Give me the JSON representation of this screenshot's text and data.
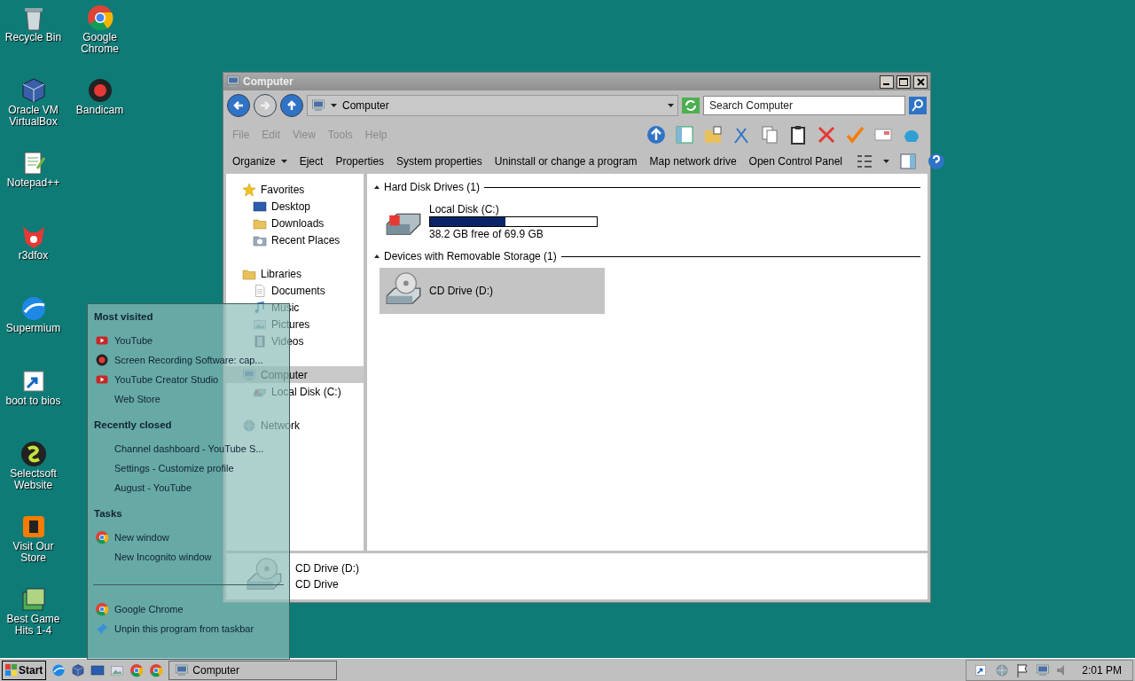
{
  "desktop": {
    "columns": [
      [
        {
          "label": "Recycle Bin",
          "kind": "recycle"
        },
        {
          "label": "Oracle VM VirtualBox",
          "kind": "cube"
        },
        {
          "label": "Notepad++",
          "kind": "notepad"
        },
        {
          "label": "r3dfox",
          "kind": "fox"
        },
        {
          "label": "Supermium",
          "kind": "globe"
        },
        {
          "label": "boot to bios",
          "kind": "shortcut"
        },
        {
          "label": "Selectsoft Website",
          "kind": "selectsoft"
        },
        {
          "label": "Visit Our Store",
          "kind": "store"
        },
        {
          "label": "Best Game Hits 1-4",
          "kind": "game"
        }
      ],
      [
        {
          "label": "Google Chrome",
          "kind": "chrome"
        },
        {
          "label": "Bandicam",
          "kind": "record"
        }
      ]
    ]
  },
  "window": {
    "title": "Computer",
    "address": "Computer",
    "search": {
      "placeholder": "Search Computer"
    },
    "menu": [
      {
        "label": "File",
        "disabled": true
      },
      {
        "label": "Edit",
        "disabled": true
      },
      {
        "label": "View",
        "disabled": true
      },
      {
        "label": "Tools",
        "disabled": true
      },
      {
        "label": "Help",
        "disabled": true
      }
    ],
    "commands": [
      {
        "label": "Organize",
        "dropdown": true
      },
      {
        "label": "Eject",
        "dropdown": false
      },
      {
        "label": "Properties",
        "dropdown": false
      },
      {
        "label": "System properties",
        "dropdown": false
      },
      {
        "label": "Uninstall or change a program",
        "dropdown": false
      },
      {
        "label": "Map network drive",
        "dropdown": false
      },
      {
        "label": "Open Control Panel",
        "dropdown": false
      }
    ],
    "navigation": [
      {
        "label": "Favorites",
        "kind": "star",
        "selected": false,
        "children": [
          {
            "label": "Desktop",
            "kind": "desktop",
            "selected": false
          },
          {
            "label": "Downloads",
            "kind": "folder",
            "selected": false
          },
          {
            "label": "Recent Places",
            "kind": "recent",
            "selected": false
          }
        ]
      },
      {
        "label": "Libraries",
        "kind": "library",
        "selected": false,
        "children": [
          {
            "label": "Documents",
            "kind": "doc",
            "selected": false
          },
          {
            "label": "Music",
            "kind": "music",
            "selected": false
          },
          {
            "label": "Pictures",
            "kind": "picture",
            "selected": false
          },
          {
            "label": "Videos",
            "kind": "video",
            "selected": false
          }
        ]
      },
      {
        "label": "Computer",
        "kind": "computer",
        "selected": true,
        "children": [
          {
            "label": "Local Disk (C:)",
            "kind": "disk",
            "selected": false
          }
        ]
      },
      {
        "label": "Network",
        "kind": "network",
        "selected": false
      }
    ],
    "groups": [
      {
        "title": "Hard Disk Drives (1)",
        "items": [
          {
            "name": "Local Disk (C:)",
            "kind": "disk",
            "selected": false,
            "level": 0.45,
            "free": "38.2 GB free of 69.9 GB"
          }
        ]
      },
      {
        "title": "Devices with Removable Storage (1)",
        "items": [
          {
            "name": "CD Drive (D:)",
            "kind": "cd",
            "selected": true
          }
        ]
      }
    ],
    "details": {
      "name": "CD Drive (D:)",
      "type": "CD Drive"
    }
  },
  "jump_list": {
    "sections": [
      {
        "title": "Most visited",
        "items": [
          {
            "label": "YouTube",
            "kind": "youtube"
          },
          {
            "label": "Screen Recording Software: cap...",
            "kind": "record"
          },
          {
            "label": "YouTube Creator Studio",
            "kind": "youtube"
          },
          {
            "label": "Web Store",
            "kind": "none"
          }
        ]
      },
      {
        "title": "Recently closed",
        "items": [
          {
            "label": "Channel dashboard - YouTube S...",
            "kind": "none"
          },
          {
            "label": "Settings - Customize profile",
            "kind": "none"
          },
          {
            "label": "August - YouTube",
            "kind": "none"
          }
        ]
      },
      {
        "title": "Tasks",
        "items": [
          {
            "label": "New window",
            "kind": "chrome"
          },
          {
            "label": "New Incognito window",
            "kind": "none"
          }
        ]
      }
    ],
    "pinned": [
      {
        "label": "Google Chrome",
        "kind": "chrome"
      },
      {
        "label": "Unpin this program from taskbar",
        "kind": "unpin"
      }
    ]
  },
  "taskbar": {
    "start": "Start",
    "tasks": [
      {
        "label": "Computer",
        "selected": false
      }
    ],
    "clock": "2:01 PM"
  }
}
